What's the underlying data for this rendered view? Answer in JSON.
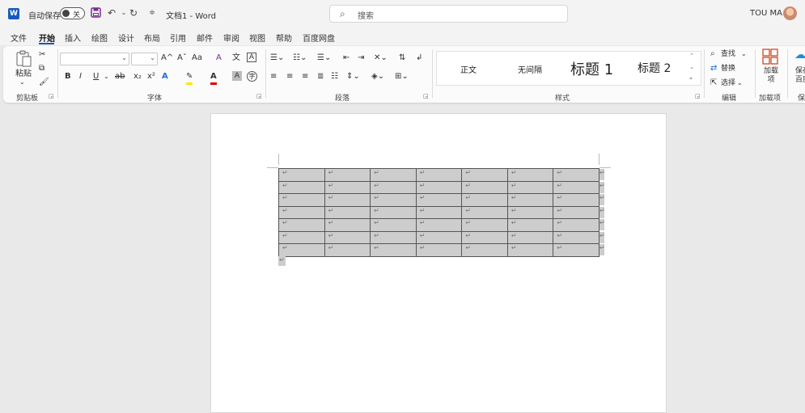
{
  "titlebar": {
    "app_logo": "W",
    "autosave_label": "自动保存",
    "autosave_state": "关",
    "doc_title": "文档1 - Word",
    "search_placeholder": "搜索",
    "user_name": "TOU MA",
    "icons": [
      "save-icon",
      "undo-icon",
      "redo-icon",
      "customize-icon",
      "search-icon"
    ]
  },
  "tabs": [
    "文件",
    "开始",
    "插入",
    "绘图",
    "设计",
    "布局",
    "引用",
    "邮件",
    "审阅",
    "视图",
    "帮助",
    "百度网盘"
  ],
  "active_tab": "开始",
  "ribbon": {
    "clipboard": {
      "label": "剪贴板",
      "paste": "粘贴"
    },
    "font": {
      "label": "字体",
      "bold": "B",
      "italic": "I",
      "underline": "U",
      "strike": "ab",
      "subscript": "x₂",
      "superscript": "x²",
      "grow": "A^",
      "shrink": "Aˇ",
      "case": "Aa",
      "clear": "A",
      "phonetic": "文",
      "border": "A",
      "effects": "A",
      "shade": "A",
      "circle": "字"
    },
    "paragraph": {
      "label": "段落"
    },
    "styles": {
      "label": "样式",
      "items": [
        "正文",
        "无间隔",
        "标题 1",
        "标题 2"
      ]
    },
    "editing": {
      "label": "编辑",
      "find": "查找",
      "replace": "替换",
      "select": "选择"
    },
    "addins": {
      "label": "加载项",
      "button": "加载项"
    },
    "baidu": {
      "label": "保",
      "button": "保存百度"
    }
  },
  "document": {
    "table": {
      "rows": 7,
      "cols": 7,
      "cell_mark": "↵"
    },
    "para_mark": "↵"
  }
}
